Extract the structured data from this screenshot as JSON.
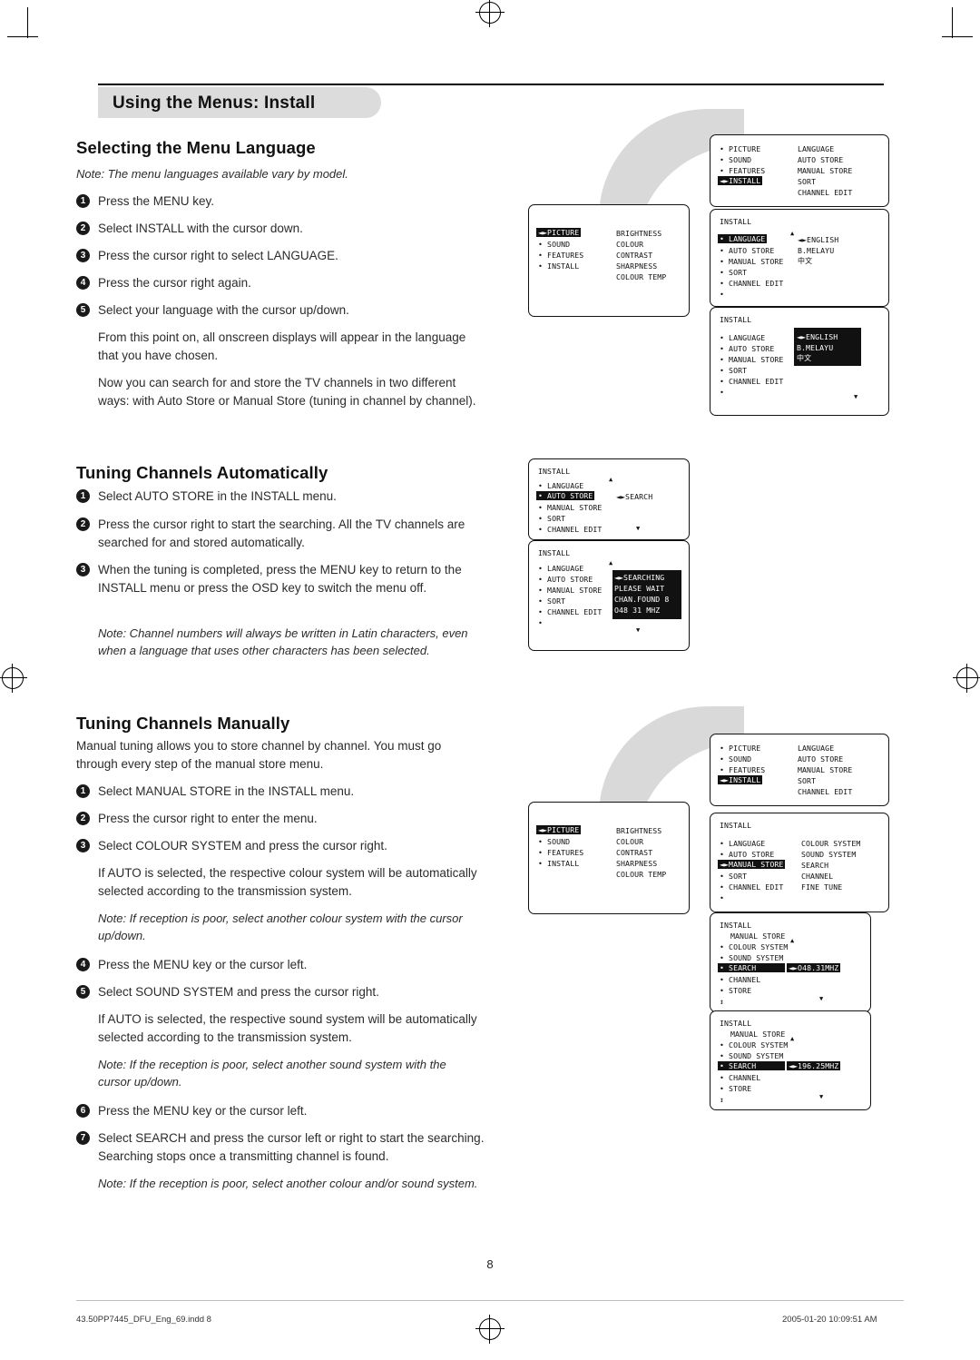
{
  "header": {
    "title": "Using the Menus: Install"
  },
  "sections": {
    "language": {
      "title": "Selecting the Menu Language",
      "note": "Note: The menu languages available vary by model.",
      "steps": [
        {
          "n": "1",
          "text": "Press the MENU key."
        },
        {
          "n": "2",
          "text": "Select INSTALL with the cursor down."
        },
        {
          "n": "3",
          "text": "Press the cursor right to select LANGUAGE."
        },
        {
          "n": "4",
          "text": "Press the cursor right again."
        },
        {
          "n": "5",
          "text": "Select your language with the cursor up/down."
        }
      ],
      "para1": "From this point on, all onscreen displays will appear in the language that you have chosen.",
      "para2": "Now you can search for and store the TV channels in two different ways: with Auto Store or Manual Store (tuning in channel by channel)."
    },
    "auto": {
      "title": "Tuning Channels Automatically",
      "steps": [
        {
          "n": "1",
          "text": "Select AUTO STORE in the INSTALL menu."
        },
        {
          "n": "2",
          "text": "Press the cursor right to start the searching. All the TV channels are searched for and stored automatically."
        },
        {
          "n": "3",
          "text": "When the tuning is completed, press the MENU key to return to the INSTALL menu or press the OSD key to switch the menu off."
        }
      ],
      "note": "Note: Channel numbers will always be written in Latin characters, even when a language that uses other characters has been selected."
    },
    "manual": {
      "title": "Tuning Channels Manually",
      "intro": "Manual tuning allows you to store channel by channel. You must go through every step of the manual store menu.",
      "steps": [
        {
          "n": "1",
          "text": "Select MANUAL STORE in the INSTALL menu."
        },
        {
          "n": "2",
          "text": "Press the cursor right to enter the menu."
        },
        {
          "n": "3",
          "text": "Select COLOUR SYSTEM and press the cursor right."
        }
      ],
      "para1": "If AUTO is selected, the respective colour system will be automatically selected according to the transmission system.",
      "note1": "Note: If reception is poor, select another colour system with the cursor up/down.",
      "steps2": [
        {
          "n": "4",
          "text": "Press the MENU key or the cursor left."
        },
        {
          "n": "5",
          "text": "Select SOUND SYSTEM and press the cursor right."
        }
      ],
      "para2": "If AUTO is selected, the respective sound system will be automatically selected according to the transmission system.",
      "note2": "Note: If the reception is poor, select another sound system with the cursor up/down.",
      "steps3": [
        {
          "n": "6",
          "text": "Press the MENU key or the cursor left."
        },
        {
          "n": "7",
          "text": "Select SEARCH and press the cursor left or right to start the searching. Searching stops once a transmitting channel is found."
        }
      ],
      "note3": "Note: If the reception is poor, select another colour and/or sound system."
    }
  },
  "osd": {
    "menu_top1": {
      "left": [
        "• PICTURE",
        "• SOUND",
        "• FEATURES"
      ],
      "highlight": "◄►INSTALL",
      "right": [
        "LANGUAGE",
        "AUTO STORE",
        "MANUAL STORE",
        "SORT",
        "CHANNEL EDIT"
      ]
    },
    "menu_picture1": {
      "highlight": "◄►PICTURE",
      "left": [
        "• SOUND",
        "• FEATURES",
        "• INSTALL"
      ],
      "right": [
        "BRIGHTNESS",
        "COLOUR",
        "CONTRAST",
        "SHARPNESS",
        "COLOUR TEMP"
      ]
    },
    "install_lang": {
      "title": "INSTALL",
      "highlight": "• LANGUAGE",
      "left": [
        "• AUTO STORE",
        "• MANUAL STORE",
        "• SORT",
        "• CHANNEL EDIT",
        "•"
      ],
      "right": [
        "◄►ENGLISH",
        "B.MELAYU",
        "中文"
      ]
    },
    "install_lang_sel": {
      "title": "INSTALL",
      "left": [
        "• LANGUAGE",
        "• AUTO STORE",
        "• MANUAL STORE",
        "• SORT",
        "• CHANNEL EDIT",
        "•"
      ],
      "right_highlight": "◄►ENGLISH",
      "right": [
        "B.MELAYU",
        "中文"
      ]
    },
    "install_auto": {
      "title": "INSTALL",
      "left_top": "• LANGUAGE",
      "highlight": "• AUTO STORE",
      "left": [
        "• MANUAL STORE",
        "• SORT",
        "• CHANNEL EDIT",
        "•"
      ],
      "right": "◄►SEARCH"
    },
    "install_searching": {
      "title": "INSTALL",
      "left": [
        "• LANGUAGE",
        "• AUTO STORE",
        "• MANUAL STORE",
        "• SORT",
        "• CHANNEL EDIT",
        "•"
      ],
      "panel": [
        "◄►SEARCHING",
        "PLEASE WAIT",
        "CHAN.FOUND 8",
        "O48 31 MHZ"
      ]
    },
    "menu_top2": {
      "left": [
        "• PICTURE",
        "• SOUND",
        "• FEATURES"
      ],
      "highlight": "◄►INSTALL",
      "right": [
        "LANGUAGE",
        "AUTO STORE",
        "MANUAL STORE",
        "SORT",
        "CHANNEL EDIT"
      ]
    },
    "menu_picture2": {
      "highlight": "◄►PICTURE",
      "left": [
        "• SOUND",
        "• FEATURES",
        "• INSTALL"
      ],
      "right": [
        "BRIGHTNESS",
        "COLOUR",
        "CONTRAST",
        "SHARPNESS",
        "COLOUR TEMP"
      ]
    },
    "install_manual": {
      "title": "INSTALL",
      "left": [
        "• LANGUAGE",
        "• AUTO STORE"
      ],
      "highlight": "◄►MANUAL STORE",
      "left2": [
        "• SORT",
        "• CHANNEL EDIT",
        "•"
      ],
      "right": [
        "COLOUR SYSTEM",
        "SOUND SYSTEM",
        "SEARCH",
        "CHANNEL",
        "FINE TUNE"
      ]
    },
    "install_search1": {
      "title": "INSTALL",
      "sub": "MANUAL STORE",
      "left": [
        "• COLOUR SYSTEM",
        "• SOUND SYSTEM"
      ],
      "highlight": "• SEARCH",
      "value": "◄►O48.31MHZ",
      "left2": [
        "• CHANNEL",
        "• STORE"
      ]
    },
    "install_search2": {
      "title": "INSTALL",
      "sub": "MANUAL STORE",
      "left": [
        "• COLOUR SYSTEM",
        "• SOUND SYSTEM"
      ],
      "highlight": "• SEARCH",
      "value": "◄►196.25MHZ",
      "left2": [
        "• CHANNEL",
        "• STORE"
      ]
    }
  },
  "page_number": "8",
  "footer": {
    "left": "43.50PP7445_DFU_Eng_69.indd   8",
    "right": "2005-01-20   10:09:51 AM"
  }
}
